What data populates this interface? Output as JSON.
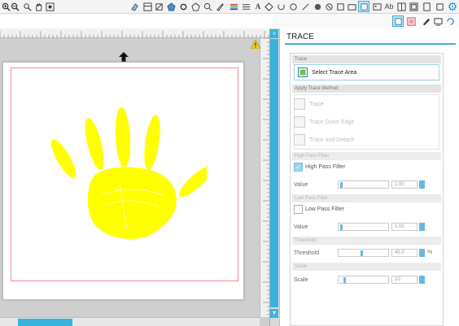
{
  "toolbar": {
    "icons": [
      "zoom-in-icon",
      "zoom-out-icon",
      "drag-zoom-icon",
      "pan-hand-icon",
      "zoom-fit-icon",
      "eraser-icon",
      "layout-icon",
      "draw-icon",
      "pentagon-icon",
      "gear-shape-icon",
      "lasso-icon",
      "search-shape-icon",
      "text-tool-icon"
    ],
    "right_labels": {
      "text_A": "A",
      "text_Ab": "Ab"
    }
  },
  "canvas": {
    "mat_color": "#ffffff",
    "cutline_color": "#f08c94",
    "shape_color": "#ffff00",
    "shape_name": "hand-print"
  },
  "panel": {
    "title": "TRACE",
    "sections": {
      "trace": "Trace",
      "apply_method": "Apply Trace Method",
      "high_pass": "High Pass Filter",
      "low_pass": "Low Pass Filter",
      "threshold": "Threshold",
      "scale": "Scale"
    },
    "select_area_label": "Select Trace Area",
    "methods": [
      "Trace",
      "Trace Outer Edge",
      "Trace and Detach"
    ],
    "high_pass_label": "High Pass Filter",
    "high_pass_checked": true,
    "low_pass_label": "Low Pass Filter",
    "low_pass_checked": false,
    "value_label": "Value",
    "high_pass_value": "1.00",
    "low_pass_value": "1.00",
    "threshold_label": "Threshold",
    "threshold_value": "45.0",
    "threshold_unit": "%",
    "scale_label": "Scale",
    "scale_value": "10",
    "accent_color": "#38b3dc"
  }
}
